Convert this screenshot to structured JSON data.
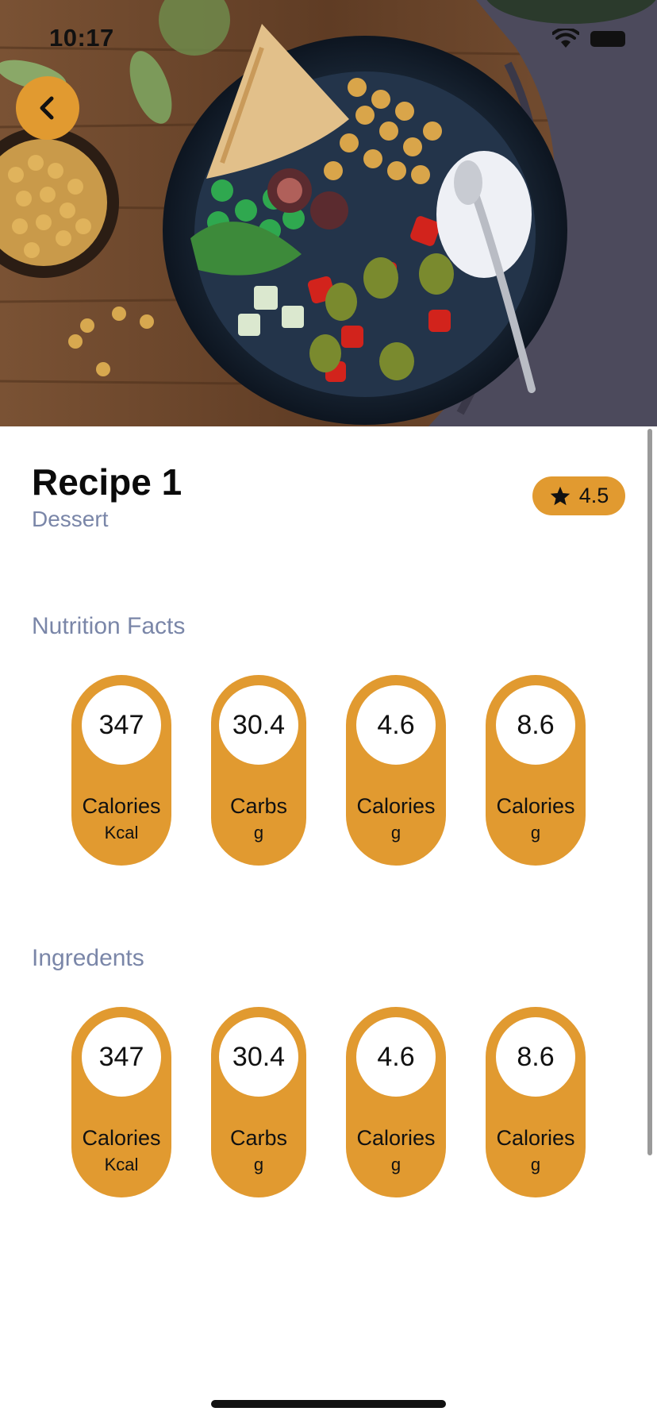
{
  "status_bar": {
    "time": "10:17"
  },
  "recipe": {
    "title": "Recipe 1",
    "category": "Dessert",
    "rating": "4.5"
  },
  "nutrition": {
    "title": "Nutrition Facts",
    "items": [
      {
        "value": "347",
        "label": "Calories",
        "unit": "Kcal"
      },
      {
        "value": "30.4",
        "label": "Carbs",
        "unit": "g"
      },
      {
        "value": "4.6",
        "label": "Calories",
        "unit": "g"
      },
      {
        "value": "8.6",
        "label": "Calories",
        "unit": "g"
      }
    ]
  },
  "ingredients": {
    "title": "Ingredents",
    "items": [
      {
        "value": "347",
        "label": "Calories",
        "unit": "Kcal"
      },
      {
        "value": "30.4",
        "label": "Carbs",
        "unit": "g"
      },
      {
        "value": "4.6",
        "label": "Calories",
        "unit": "g"
      },
      {
        "value": "8.6",
        "label": "Calories",
        "unit": "g"
      }
    ]
  },
  "colors": {
    "accent": "#e19a30",
    "muted_text": "#7a86a8"
  },
  "icons": {
    "back": "chevron-left-icon",
    "rating": "star-icon",
    "wifi": "wifi-icon",
    "battery": "battery-icon"
  }
}
